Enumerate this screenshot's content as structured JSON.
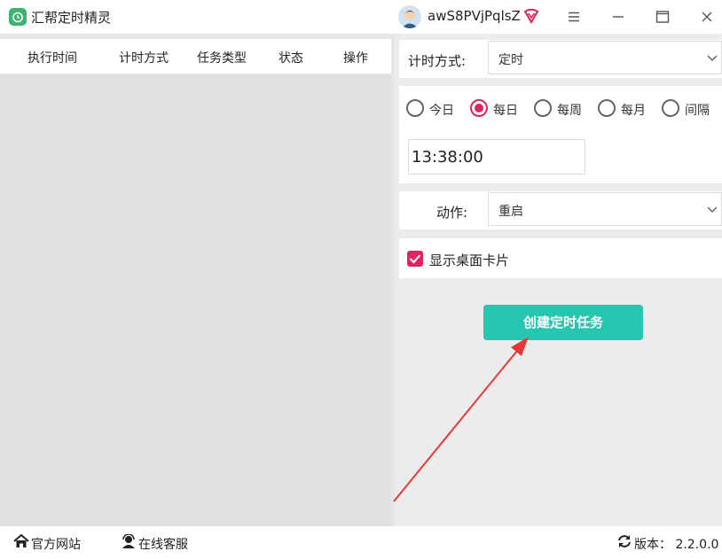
{
  "app": {
    "title": "汇帮定时精灵",
    "username": "awS8PVjPqlsZ"
  },
  "table": {
    "columns": [
      "执行时间",
      "计时方式",
      "任务类型",
      "状态",
      "操作"
    ]
  },
  "form": {
    "timing_mode_label": "计时方式:",
    "timing_mode_value": "定时",
    "frequency_options": [
      {
        "label": "今日",
        "selected": false
      },
      {
        "label": "每日",
        "selected": true
      },
      {
        "label": "每周",
        "selected": false
      },
      {
        "label": "每月",
        "selected": false
      },
      {
        "label": "间隔",
        "selected": false
      }
    ],
    "time_value": "13:38:00",
    "action_label": "动作:",
    "action_value": "重启",
    "show_card_label": "显示桌面卡片",
    "show_card_checked": true,
    "create_button": "创建定时任务"
  },
  "status_bar": {
    "website_label": "官方网站",
    "support_label": "在线客服",
    "version_label": "版本： 2.2.0.0"
  },
  "colors": {
    "accent": "#e0245e",
    "primary_button": "#26c6b0",
    "annotation_arrow": "#e53935"
  }
}
